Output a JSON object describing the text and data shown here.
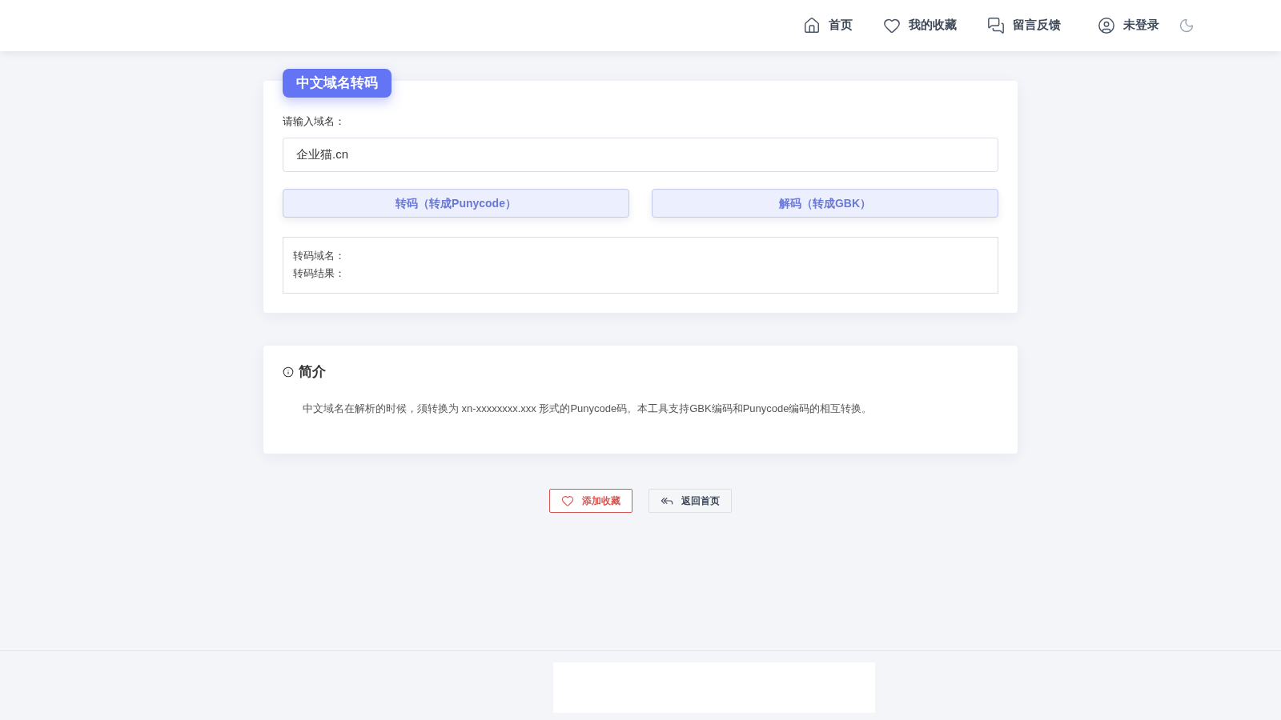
{
  "header": {
    "nav": [
      {
        "label": "首页"
      },
      {
        "label": "我的收藏"
      },
      {
        "label": "留言反馈"
      },
      {
        "label": "未登录"
      }
    ]
  },
  "tool": {
    "title": "中文域名转码",
    "input": {
      "label": "请输入域名：",
      "value": "企业猫.cn"
    },
    "buttons": [
      "转码（转成Punycode）",
      "解码（转成GBK）"
    ],
    "result": {
      "lines": [
        "转码域名：",
        "转码结果："
      ]
    }
  },
  "intro": {
    "heading": "简介",
    "text": "中文域名在解析的时候，须转换为 xn-xxxxxxxx.xxx 形式的Punycode码。本工具支持GBK编码和Punycode编码的相互转换。"
  },
  "actions": [
    {
      "kind": "favorite",
      "label": "添加收藏"
    },
    {
      "kind": "home",
      "label": "返回首页"
    }
  ]
}
